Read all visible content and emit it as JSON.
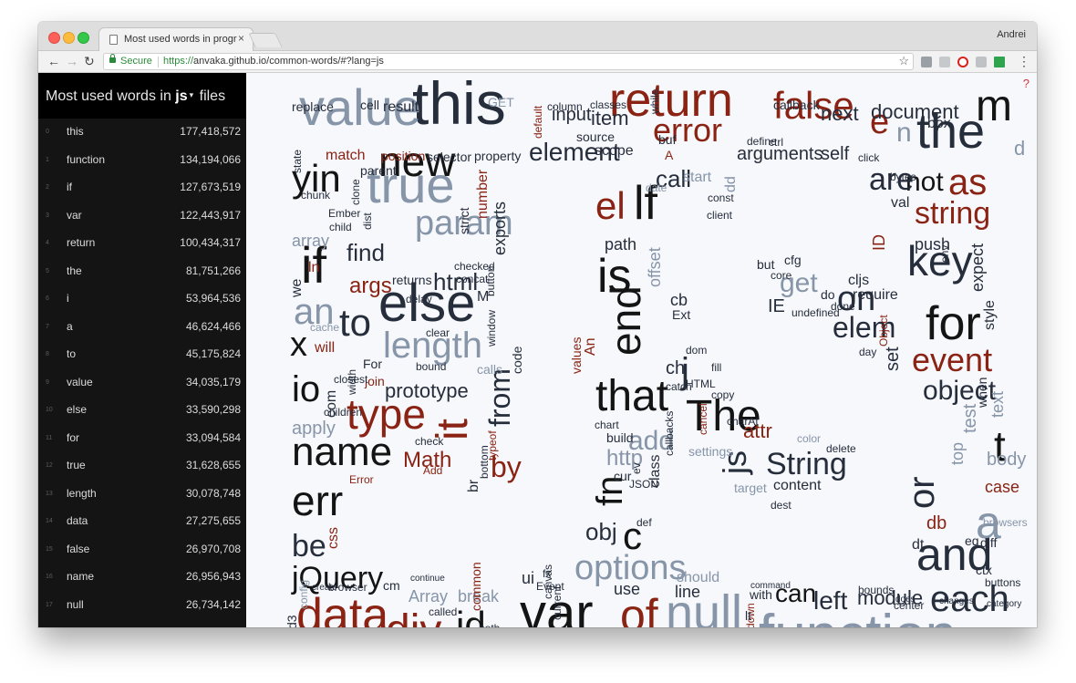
{
  "browser": {
    "tab_title": "Most used words in programm",
    "tab_close": "×",
    "profile": "Andrei",
    "secure_label": "Secure",
    "url_scheme": "https://",
    "url_rest": "anvaka.github.io/common-words/#?lang=js",
    "nav_back": "←",
    "nav_forward": "→",
    "nav_reload": "↻",
    "star": "☆",
    "menu": "⋮"
  },
  "sidebar": {
    "title_prefix": "Most used words in",
    "language": "js",
    "caret": "▾",
    "title_suffix": "files",
    "items": [
      {
        "index": "0",
        "word": "this",
        "count": "177,418,572"
      },
      {
        "index": "1",
        "word": "function",
        "count": "134,194,066"
      },
      {
        "index": "2",
        "word": "if",
        "count": "127,673,519"
      },
      {
        "index": "3",
        "word": "var",
        "count": "122,443,917"
      },
      {
        "index": "4",
        "word": "return",
        "count": "100,434,317"
      },
      {
        "index": "5",
        "word": "the",
        "count": "81,751,266"
      },
      {
        "index": "6",
        "word": "i",
        "count": "53,964,536"
      },
      {
        "index": "7",
        "word": "a",
        "count": "46,624,466"
      },
      {
        "index": "8",
        "word": "to",
        "count": "45,175,824"
      },
      {
        "index": "9",
        "word": "value",
        "count": "34,035,179"
      },
      {
        "index": "10",
        "word": "else",
        "count": "33,590,298"
      },
      {
        "index": "11",
        "word": "for",
        "count": "33,094,584"
      },
      {
        "index": "12",
        "word": "true",
        "count": "31,628,655"
      },
      {
        "index": "13",
        "word": "length",
        "count": "30,078,748"
      },
      {
        "index": "14",
        "word": "data",
        "count": "27,275,655"
      },
      {
        "index": "15",
        "word": "false",
        "count": "26,970,708"
      },
      {
        "index": "16",
        "word": "name",
        "count": "26,956,943"
      },
      {
        "index": "17",
        "word": "null",
        "count": "26,734,142"
      }
    ]
  },
  "help": "?",
  "colors": {
    "dark": "#262d3b",
    "gray": "#8795a8",
    "red": "#8a2313",
    "black": "#141414"
  },
  "cloud_words": [
    {
      "t": "this",
      "c": "dark"
    },
    {
      "t": "value",
      "c": "gray"
    },
    {
      "t": "return",
      "c": "red"
    },
    {
      "t": "false",
      "c": "red"
    },
    {
      "t": "error",
      "c": "red"
    },
    {
      "t": "the",
      "c": "dark"
    },
    {
      "t": "m",
      "c": "black"
    },
    {
      "t": "e",
      "c": "red"
    },
    {
      "t": "n",
      "c": "gray"
    },
    {
      "t": "new",
      "c": "black"
    },
    {
      "t": "true",
      "c": "gray"
    },
    {
      "t": "yin",
      "c": "black"
    },
    {
      "t": "param",
      "c": "gray"
    },
    {
      "t": "if",
      "c": "black"
    },
    {
      "t": "else",
      "c": "dark"
    },
    {
      "t": "an",
      "c": "gray"
    },
    {
      "t": "to",
      "c": "dark"
    },
    {
      "t": "length",
      "c": "gray"
    },
    {
      "t": "x",
      "c": "black"
    },
    {
      "t": "io",
      "c": "black"
    },
    {
      "t": "type",
      "c": "red"
    },
    {
      "t": "name",
      "c": "black"
    },
    {
      "t": "err",
      "c": "black"
    },
    {
      "t": "be",
      "c": "dark"
    },
    {
      "t": "jQuery",
      "c": "black"
    },
    {
      "t": "data",
      "c": "red"
    },
    {
      "t": "div",
      "c": "red"
    },
    {
      "t": "id",
      "c": "black"
    },
    {
      "t": "var",
      "c": "black"
    },
    {
      "t": "of",
      "c": "red"
    },
    {
      "t": "null",
      "c": "gray"
    },
    {
      "t": "function",
      "c": "gray"
    },
    {
      "t": "each",
      "c": "dark"
    },
    {
      "t": "and",
      "c": "dark"
    },
    {
      "t": "a",
      "c": "gray"
    },
    {
      "t": "or",
      "c": "dark"
    },
    {
      "t": "t",
      "c": "black"
    },
    {
      "t": "object",
      "c": "dark"
    },
    {
      "t": "event",
      "c": "red"
    },
    {
      "t": "for",
      "c": "black"
    },
    {
      "t": "key",
      "c": "dark"
    },
    {
      "t": "string",
      "c": "red"
    },
    {
      "t": "as",
      "c": "red"
    },
    {
      "t": "not",
      "c": "black"
    },
    {
      "t": "are",
      "c": "dark"
    },
    {
      "t": "is",
      "c": "black"
    },
    {
      "t": "end",
      "c": "black"
    },
    {
      "t": "that",
      "c": "black"
    },
    {
      "t": "The",
      "c": "black"
    },
    {
      "t": "el",
      "c": "red"
    },
    {
      "t": "lf",
      "c": "black"
    },
    {
      "t": "element",
      "c": "dark"
    },
    {
      "t": "options",
      "c": "gray"
    },
    {
      "t": "c",
      "c": "black"
    },
    {
      "t": "fn",
      "c": "black"
    },
    {
      "t": "from",
      "c": "dark"
    },
    {
      "t": "it",
      "c": "red"
    },
    {
      "t": "on",
      "c": "dark"
    },
    {
      "t": "elem",
      "c": "dark"
    },
    {
      "t": "get",
      "c": "gray"
    },
    {
      "t": "String",
      "c": "dark"
    },
    {
      "t": "add",
      "c": "gray"
    },
    {
      "t": "by",
      "c": "red"
    },
    {
      "t": "document",
      "c": "dark"
    },
    {
      "t": "next",
      "c": "dark"
    },
    {
      "t": "call",
      "c": "dark"
    },
    {
      "t": "arguments",
      "c": "dark"
    },
    {
      "t": "prototype",
      "c": "dark"
    },
    {
      "t": "find",
      "c": "dark"
    },
    {
      "t": "html",
      "c": "dark"
    },
    {
      "t": "args",
      "c": "red"
    },
    {
      "t": "can",
      "c": "black"
    },
    {
      "t": "left",
      "c": "dark"
    },
    {
      "t": "module",
      "c": "dark"
    },
    {
      "t": "index",
      "c": "red"
    },
    {
      "t": "node",
      "c": "red"
    },
    {
      "t": "height",
      "c": "gray"
    },
    {
      "t": "http",
      "c": "gray"
    },
    {
      "t": "Math",
      "c": "red"
    },
    {
      "t": "apply",
      "c": "gray"
    },
    {
      "t": "obj",
      "c": "dark"
    },
    {
      "t": "js",
      "c": "dark"
    },
    {
      "t": "j",
      "c": "dark"
    },
    {
      "t": "input",
      "c": "dark"
    },
    {
      "t": "item",
      "c": "dark"
    },
    {
      "t": "source",
      "c": "dark"
    },
    {
      "t": "self",
      "c": "dark"
    },
    {
      "t": "match",
      "c": "red"
    },
    {
      "t": "position",
      "c": "red"
    },
    {
      "t": "attr",
      "c": "red"
    },
    {
      "t": "body",
      "c": "gray"
    },
    {
      "t": "case",
      "c": "red"
    },
    {
      "t": "push",
      "c": "dark"
    },
    {
      "t": "replace",
      "c": "dark"
    },
    {
      "t": "cell",
      "c": "dark"
    },
    {
      "t": "result",
      "c": "dark"
    },
    {
      "t": "array",
      "c": "gray"
    },
    {
      "t": "we",
      "c": "dark"
    },
    {
      "t": "will",
      "c": "red"
    },
    {
      "t": "returns",
      "c": "dark"
    },
    {
      "t": "css",
      "c": "red"
    },
    {
      "t": "config",
      "c": "gray"
    },
    {
      "t": "method",
      "c": "gray"
    },
    {
      "t": "Array",
      "c": "gray"
    },
    {
      "t": "break",
      "c": "gray"
    },
    {
      "t": "ui",
      "c": "dark"
    },
    {
      "t": "use",
      "c": "dark"
    },
    {
      "t": "line",
      "c": "dark"
    },
    {
      "t": "should",
      "c": "gray"
    },
    {
      "t": "with",
      "c": "dark"
    },
    {
      "t": "ID",
      "c": "red"
    },
    {
      "t": "cfg",
      "c": "dark"
    },
    {
      "t": "require",
      "c": "dark"
    },
    {
      "t": "cljs",
      "c": "dark"
    },
    {
      "t": "expect",
      "c": "dark"
    },
    {
      "t": "style",
      "c": "dark"
    },
    {
      "t": "test",
      "c": "gray"
    },
    {
      "t": "top",
      "c": "gray"
    },
    {
      "t": "when",
      "c": "dark"
    },
    {
      "t": "text",
      "c": "gray"
    },
    {
      "t": "db",
      "c": "red"
    },
    {
      "t": "dt",
      "c": "dark"
    },
    {
      "t": "eq",
      "c": "dark"
    },
    {
      "t": "diff",
      "c": "dark"
    },
    {
      "t": "path",
      "c": "dark"
    },
    {
      "t": "offset",
      "c": "gray"
    },
    {
      "t": "cb",
      "c": "dark"
    },
    {
      "t": "ch",
      "c": "dark"
    },
    {
      "t": "Ext",
      "c": "dark"
    },
    {
      "t": "class",
      "c": "dark"
    },
    {
      "t": "cur",
      "c": "dark"
    },
    {
      "t": "build",
      "c": "dark"
    },
    {
      "t": "chart",
      "c": "dark"
    },
    {
      "t": "check",
      "c": "dark"
    },
    {
      "t": "settings",
      "c": "gray"
    },
    {
      "t": "target",
      "c": "gray"
    },
    {
      "t": "content",
      "c": "dark"
    },
    {
      "t": "dest",
      "c": "dark"
    },
    {
      "t": "color",
      "c": "gray"
    },
    {
      "t": "undefined",
      "c": "dark"
    },
    {
      "t": "IE",
      "c": "dark"
    },
    {
      "t": "but",
      "c": "dark"
    },
    {
      "t": "core",
      "c": "dark"
    },
    {
      "t": "set",
      "c": "dark"
    },
    {
      "t": "day",
      "c": "dark"
    },
    {
      "t": "Object",
      "c": "red"
    },
    {
      "t": "buf",
      "c": "dark"
    },
    {
      "t": "ctrl",
      "c": "dark"
    },
    {
      "t": "box",
      "c": "dark"
    },
    {
      "t": "callback",
      "c": "dark"
    },
    {
      "t": "scope",
      "c": "dark"
    },
    {
      "t": "start",
      "c": "gray"
    },
    {
      "t": "selector",
      "c": "dark"
    },
    {
      "t": "property",
      "c": "dark"
    },
    {
      "t": "parent",
      "c": "dark"
    },
    {
      "t": "state",
      "c": "dark"
    },
    {
      "t": "number",
      "c": "red"
    },
    {
      "t": "exports",
      "c": "dark"
    },
    {
      "t": "strict",
      "c": "dark"
    },
    {
      "t": "button",
      "c": "dark"
    },
    {
      "t": "window",
      "c": "dark"
    },
    {
      "t": "code",
      "c": "dark"
    },
    {
      "t": "calls",
      "c": "gray"
    },
    {
      "t": "clear",
      "c": "dark"
    },
    {
      "t": "bound",
      "c": "dark"
    },
    {
      "t": "For",
      "c": "dark"
    },
    {
      "t": "join",
      "c": "red"
    },
    {
      "t": "com",
      "c": "dark"
    },
    {
      "t": "width",
      "c": "dark"
    },
    {
      "t": "Error",
      "c": "red"
    },
    {
      "t": "Add",
      "c": "red"
    },
    {
      "t": "typeof",
      "c": "red"
    },
    {
      "t": "br",
      "c": "dark"
    },
    {
      "t": "bottom",
      "c": "dark"
    },
    {
      "t": "browser",
      "c": "dark"
    },
    {
      "t": "create",
      "c": "dark"
    },
    {
      "t": "called",
      "c": "dark"
    },
    {
      "t": "both",
      "c": "dark"
    },
    {
      "t": "canvas",
      "c": "dark"
    },
    {
      "t": "current",
      "c": "dark"
    },
    {
      "t": "values",
      "c": "red"
    },
    {
      "t": "An",
      "c": "red"
    },
    {
      "t": "def",
      "c": "dark"
    },
    {
      "t": "JSON",
      "c": "dark"
    },
    {
      "t": "GET",
      "c": "gray"
    },
    {
      "t": "while",
      "c": "dark"
    },
    {
      "t": "click",
      "c": "dark"
    },
    {
      "t": "bytes",
      "c": "dark"
    },
    {
      "t": "env",
      "c": "dark"
    },
    {
      "t": "val",
      "c": "dark"
    },
    {
      "t": "ctx",
      "c": "dark"
    },
    {
      "t": "buttons",
      "c": "dark"
    },
    {
      "t": "category",
      "c": "dark"
    },
    {
      "t": "debug",
      "c": "dark"
    },
    {
      "t": "changes",
      "c": "dark"
    },
    {
      "t": "center",
      "c": "dark"
    },
    {
      "t": "does",
      "c": "dark"
    },
    {
      "t": "bounds",
      "c": "dark"
    },
    {
      "t": "command",
      "c": "dark"
    },
    {
      "t": "down",
      "c": "red"
    },
    {
      "t": "Url",
      "c": "dark"
    },
    {
      "t": "bs",
      "c": "dark"
    },
    {
      "t": "lt",
      "c": "dark"
    },
    {
      "t": "d3",
      "c": "dark"
    },
    {
      "t": "Get",
      "c": "dark"
    },
    {
      "t": "dir",
      "c": "dark"
    },
    {
      "t": "context",
      "c": "dark"
    },
    {
      "t": "Event",
      "c": "dark"
    },
    {
      "t": "clone",
      "c": "dark"
    },
    {
      "t": "dist",
      "c": "dark"
    },
    {
      "t": "child",
      "c": "dark"
    },
    {
      "t": "Ember",
      "c": "dark"
    },
    {
      "t": "chunk",
      "c": "dark"
    },
    {
      "t": "closest",
      "c": "dark"
    },
    {
      "t": "children",
      "c": "dark"
    },
    {
      "t": "ev",
      "c": "dark"
    },
    {
      "t": "catch",
      "c": "dark"
    },
    {
      "t": "HTML",
      "c": "dark"
    },
    {
      "t": "copy",
      "c": "dark"
    },
    {
      "t": "fill",
      "c": "dark"
    },
    {
      "t": "cancel",
      "c": "red"
    },
    {
      "t": "callbacks",
      "c": "dark"
    },
    {
      "t": "charAt",
      "c": "dark"
    },
    {
      "t": "delete",
      "c": "dark"
    },
    {
      "t": "browsers",
      "c": "gray"
    },
    {
      "t": "done",
      "c": "dark"
    },
    {
      "t": "M",
      "c": "dark"
    },
    {
      "t": "ln",
      "c": "red"
    },
    {
      "t": "do",
      "c": "dark"
    },
    {
      "t": "dom",
      "c": "dark"
    },
    {
      "t": "A",
      "c": "red"
    },
    {
      "t": "d",
      "c": "gray"
    },
    {
      "t": "dd",
      "c": "gray"
    },
    {
      "t": "date",
      "c": "gray"
    },
    {
      "t": "const",
      "c": "dark"
    },
    {
      "t": "client",
      "c": "dark"
    },
    {
      "t": "checked",
      "c": "dark"
    },
    {
      "t": "concat",
      "c": "dark"
    },
    {
      "t": "delay",
      "c": "dark"
    },
    {
      "t": "cache",
      "c": "gray"
    },
    {
      "t": "column",
      "c": "dark"
    },
    {
      "t": "classes",
      "c": "dark"
    },
    {
      "t": "default",
      "c": "red"
    },
    {
      "t": "define",
      "c": "dark"
    },
    {
      "t": "fx",
      "c": "dark"
    },
    {
      "t": "cm",
      "c": "dark"
    },
    {
      "t": "continue",
      "c": "dark"
    },
    {
      "t": "common",
      "c": "red"
    }
  ]
}
